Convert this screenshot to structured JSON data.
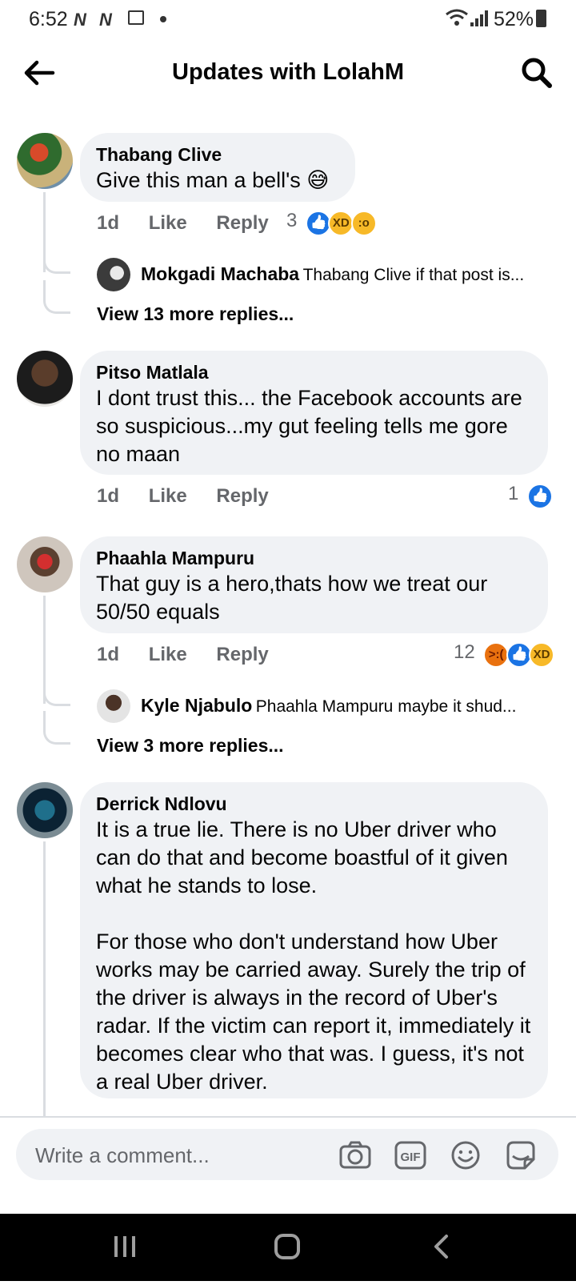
{
  "status_bar": {
    "time": "6:52",
    "notif1": "N",
    "notif2": "N",
    "battery": "52%"
  },
  "header": {
    "title": "Updates with LolahM"
  },
  "actions": {
    "like": "Like",
    "reply": "Reply"
  },
  "comments": [
    {
      "name": "Thabang Clive",
      "text": "Give this man a bell's 😅",
      "time": "1d",
      "reaction_count": "3",
      "reactions": [
        "like",
        "haha",
        "wow"
      ],
      "reply_preview": {
        "name": "Mokgadi Machaba",
        "text": "Thabang Clive if that post is..."
      },
      "more_replies": "View 13 more replies..."
    },
    {
      "name": "Pitso Matlala",
      "text": "I dont trust this... the Facebook accounts are so suspicious...my gut feeling tells me gore no maan",
      "time": "1d",
      "reaction_count": "1",
      "reactions": [
        "like"
      ]
    },
    {
      "name": "Phaahla Mampuru",
      "text": "That guy is a hero,thats how we treat our 50/50 equals",
      "time": "1d",
      "reaction_count": "12",
      "reactions": [
        "angry",
        "like",
        "haha"
      ],
      "reply_preview": {
        "name": "Kyle Njabulo",
        "text": "Phaahla Mampuru maybe it shud..."
      },
      "more_replies": "View 3 more replies..."
    },
    {
      "name": "Derrick Ndlovu",
      "text": "It is a true lie. There is no Uber driver who can do that and become boastful of it given what he stands to lose.\n\nFor those who don't understand how Uber works may be carried away. Surely the trip of the driver is always in the record of Uber's radar. If the victim can report it, immediately it becomes clear who that was. I guess, it's not a real Uber driver."
    }
  ],
  "composer": {
    "placeholder": "Write a comment..."
  },
  "icons": [
    "back-arrow-icon",
    "search-icon",
    "camera-icon",
    "gif-icon",
    "emoji-icon",
    "sticker-icon",
    "recent-apps-icon",
    "home-icon",
    "nav-back-icon"
  ],
  "colors": {
    "bubble": "#f0f2f5",
    "like_blue": "#1b74e4",
    "meta_gray": "#65676b"
  }
}
